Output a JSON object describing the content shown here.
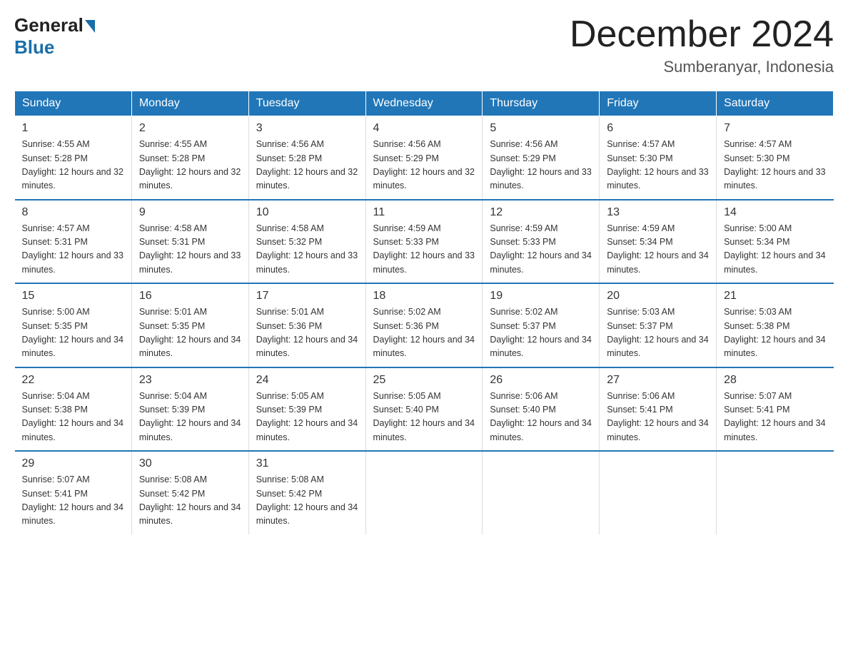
{
  "logo": {
    "general": "General",
    "blue": "Blue"
  },
  "title": "December 2024",
  "location": "Sumberanyar, Indonesia",
  "days_of_week": [
    "Sunday",
    "Monday",
    "Tuesday",
    "Wednesday",
    "Thursday",
    "Friday",
    "Saturday"
  ],
  "weeks": [
    [
      {
        "day": "1",
        "sunrise": "4:55 AM",
        "sunset": "5:28 PM",
        "daylight": "12 hours and 32 minutes."
      },
      {
        "day": "2",
        "sunrise": "4:55 AM",
        "sunset": "5:28 PM",
        "daylight": "12 hours and 32 minutes."
      },
      {
        "day": "3",
        "sunrise": "4:56 AM",
        "sunset": "5:28 PM",
        "daylight": "12 hours and 32 minutes."
      },
      {
        "day": "4",
        "sunrise": "4:56 AM",
        "sunset": "5:29 PM",
        "daylight": "12 hours and 32 minutes."
      },
      {
        "day": "5",
        "sunrise": "4:56 AM",
        "sunset": "5:29 PM",
        "daylight": "12 hours and 33 minutes."
      },
      {
        "day": "6",
        "sunrise": "4:57 AM",
        "sunset": "5:30 PM",
        "daylight": "12 hours and 33 minutes."
      },
      {
        "day": "7",
        "sunrise": "4:57 AM",
        "sunset": "5:30 PM",
        "daylight": "12 hours and 33 minutes."
      }
    ],
    [
      {
        "day": "8",
        "sunrise": "4:57 AM",
        "sunset": "5:31 PM",
        "daylight": "12 hours and 33 minutes."
      },
      {
        "day": "9",
        "sunrise": "4:58 AM",
        "sunset": "5:31 PM",
        "daylight": "12 hours and 33 minutes."
      },
      {
        "day": "10",
        "sunrise": "4:58 AM",
        "sunset": "5:32 PM",
        "daylight": "12 hours and 33 minutes."
      },
      {
        "day": "11",
        "sunrise": "4:59 AM",
        "sunset": "5:33 PM",
        "daylight": "12 hours and 33 minutes."
      },
      {
        "day": "12",
        "sunrise": "4:59 AM",
        "sunset": "5:33 PM",
        "daylight": "12 hours and 34 minutes."
      },
      {
        "day": "13",
        "sunrise": "4:59 AM",
        "sunset": "5:34 PM",
        "daylight": "12 hours and 34 minutes."
      },
      {
        "day": "14",
        "sunrise": "5:00 AM",
        "sunset": "5:34 PM",
        "daylight": "12 hours and 34 minutes."
      }
    ],
    [
      {
        "day": "15",
        "sunrise": "5:00 AM",
        "sunset": "5:35 PM",
        "daylight": "12 hours and 34 minutes."
      },
      {
        "day": "16",
        "sunrise": "5:01 AM",
        "sunset": "5:35 PM",
        "daylight": "12 hours and 34 minutes."
      },
      {
        "day": "17",
        "sunrise": "5:01 AM",
        "sunset": "5:36 PM",
        "daylight": "12 hours and 34 minutes."
      },
      {
        "day": "18",
        "sunrise": "5:02 AM",
        "sunset": "5:36 PM",
        "daylight": "12 hours and 34 minutes."
      },
      {
        "day": "19",
        "sunrise": "5:02 AM",
        "sunset": "5:37 PM",
        "daylight": "12 hours and 34 minutes."
      },
      {
        "day": "20",
        "sunrise": "5:03 AM",
        "sunset": "5:37 PM",
        "daylight": "12 hours and 34 minutes."
      },
      {
        "day": "21",
        "sunrise": "5:03 AM",
        "sunset": "5:38 PM",
        "daylight": "12 hours and 34 minutes."
      }
    ],
    [
      {
        "day": "22",
        "sunrise": "5:04 AM",
        "sunset": "5:38 PM",
        "daylight": "12 hours and 34 minutes."
      },
      {
        "day": "23",
        "sunrise": "5:04 AM",
        "sunset": "5:39 PM",
        "daylight": "12 hours and 34 minutes."
      },
      {
        "day": "24",
        "sunrise": "5:05 AM",
        "sunset": "5:39 PM",
        "daylight": "12 hours and 34 minutes."
      },
      {
        "day": "25",
        "sunrise": "5:05 AM",
        "sunset": "5:40 PM",
        "daylight": "12 hours and 34 minutes."
      },
      {
        "day": "26",
        "sunrise": "5:06 AM",
        "sunset": "5:40 PM",
        "daylight": "12 hours and 34 minutes."
      },
      {
        "day": "27",
        "sunrise": "5:06 AM",
        "sunset": "5:41 PM",
        "daylight": "12 hours and 34 minutes."
      },
      {
        "day": "28",
        "sunrise": "5:07 AM",
        "sunset": "5:41 PM",
        "daylight": "12 hours and 34 minutes."
      }
    ],
    [
      {
        "day": "29",
        "sunrise": "5:07 AM",
        "sunset": "5:41 PM",
        "daylight": "12 hours and 34 minutes."
      },
      {
        "day": "30",
        "sunrise": "5:08 AM",
        "sunset": "5:42 PM",
        "daylight": "12 hours and 34 minutes."
      },
      {
        "day": "31",
        "sunrise": "5:08 AM",
        "sunset": "5:42 PM",
        "daylight": "12 hours and 34 minutes."
      },
      null,
      null,
      null,
      null
    ]
  ]
}
